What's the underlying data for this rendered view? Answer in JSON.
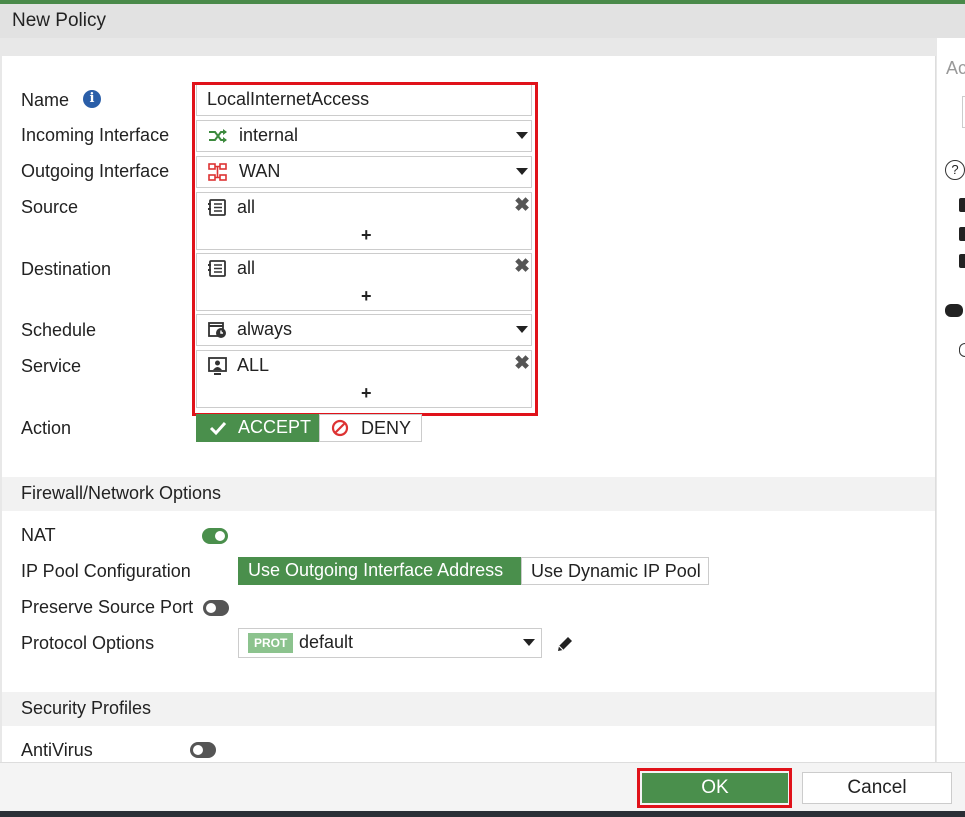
{
  "dialog": {
    "title": "New Policy"
  },
  "side_panel": {
    "label": "Ac",
    "help_glyph": "?"
  },
  "form": {
    "name": {
      "label": "Name",
      "value": "LocalInternetAccess",
      "info_icon": "i"
    },
    "incoming_interface": {
      "label": "Incoming Interface",
      "value": "internal",
      "icon": "shuffle-icon"
    },
    "outgoing_interface": {
      "label": "Outgoing Interface",
      "value": "WAN",
      "icon": "network-icon"
    },
    "source": {
      "label": "Source",
      "value": "all",
      "add": "+",
      "remove": "✖"
    },
    "destination": {
      "label": "Destination",
      "value": "all",
      "add": "+",
      "remove": "✖"
    },
    "schedule": {
      "label": "Schedule",
      "value": "always"
    },
    "service": {
      "label": "Service",
      "value": "ALL",
      "add": "+",
      "remove": "✖"
    },
    "action": {
      "label": "Action",
      "accept": "ACCEPT",
      "deny": "DENY",
      "selected": "ACCEPT"
    }
  },
  "firewall_options": {
    "title": "Firewall/Network Options",
    "nat": {
      "label": "NAT",
      "enabled": true
    },
    "ip_pool": {
      "label": "IP Pool Configuration",
      "option1": "Use Outgoing Interface Address",
      "option2": "Use Dynamic IP Pool",
      "selected": "Use Outgoing Interface Address"
    },
    "preserve_source_port": {
      "label": "Preserve Source Port",
      "enabled": false
    },
    "protocol_options": {
      "label": "Protocol Options",
      "tag": "PROT",
      "value": "default"
    }
  },
  "security_profiles": {
    "title": "Security Profiles",
    "antivirus": {
      "label": "AntiVirus",
      "enabled": false
    }
  },
  "footer": {
    "ok": "OK",
    "cancel": "Cancel"
  },
  "colors": {
    "accent_green": "#4a8f4c",
    "highlight_red": "#e0121a",
    "info_blue": "#2a5ea8"
  }
}
